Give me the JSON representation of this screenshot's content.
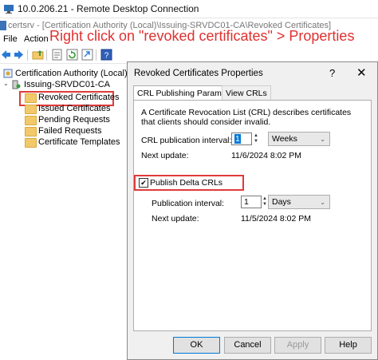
{
  "rdp": {
    "title": "10.0.206.21 - Remote Desktop Connection"
  },
  "mmc": {
    "title": "certsrv - [Certification Authority (Local)\\Issuing-SRVDC01-CA\\Revoked Certificates]"
  },
  "menu": {
    "file": "File",
    "action": "Action"
  },
  "annotation": "Right click on \"revoked certificates\" > Properties",
  "tree": {
    "root": "Certification Authority (Local)",
    "ca": "Issuing-SRVDC01-CA",
    "items": [
      "Revoked Certificates",
      "Issued Certificates",
      "Pending Requests",
      "Failed Requests",
      "Certificate Templates"
    ]
  },
  "dialog": {
    "title": "Revoked Certificates Properties",
    "help": "?",
    "close": "✕",
    "tabs": [
      "CRL Publishing Parameters",
      "View CRLs"
    ],
    "description": "A Certificate Revocation List (CRL) describes certificates that clients should consider invalid.",
    "crl_interval_label": "CRL publication interval:",
    "crl_interval_value": "1",
    "crl_interval_unit": "Weeks",
    "next_update_label": "Next update:",
    "next_update_value": "11/6/2024 8:02 PM",
    "delta_checkbox_label": "Publish Delta CRLs",
    "delta_checked": true,
    "delta_interval_label": "Publication interval:",
    "delta_interval_value": "1",
    "delta_interval_unit": "Days",
    "delta_next_update_label": "Next update:",
    "delta_next_update_value": "11/5/2024 8:02 PM",
    "buttons": {
      "ok": "OK",
      "cancel": "Cancel",
      "apply": "Apply",
      "help": "Help"
    }
  },
  "colors": {
    "annotation": "#e03030",
    "highlight": "#e03a3a",
    "folder": "#f2c96a"
  }
}
